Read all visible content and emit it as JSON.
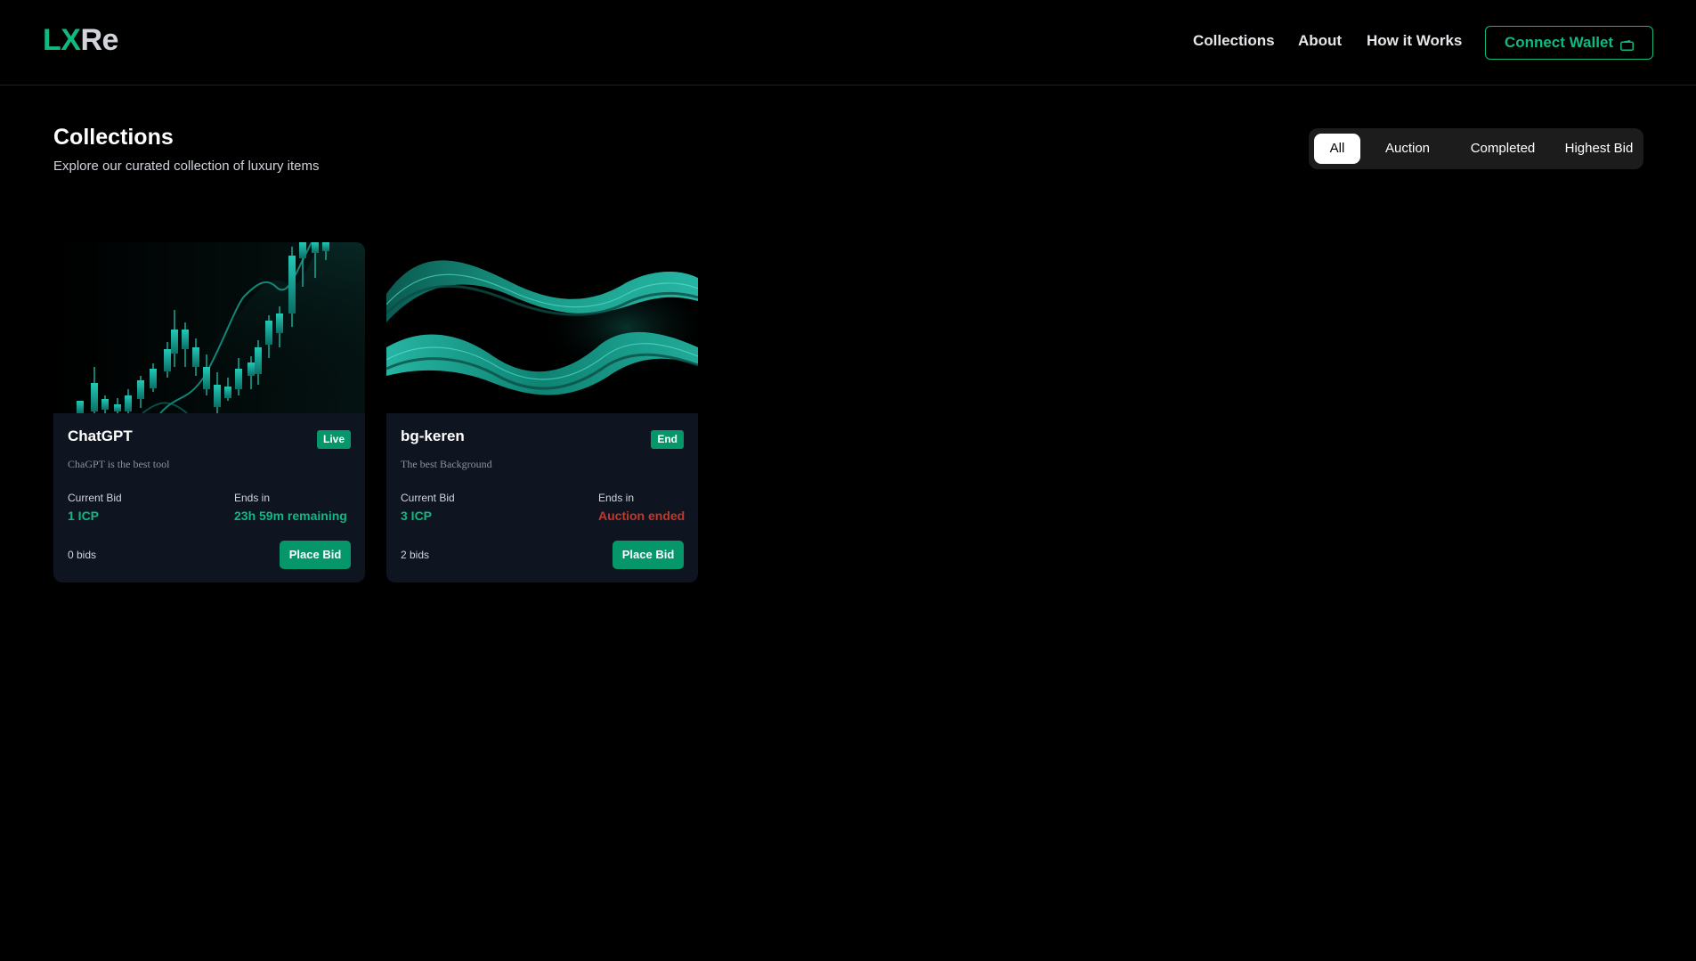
{
  "header": {
    "logo_accent": "LX",
    "logo_rest": "Re",
    "nav": [
      "Collections",
      "About",
      "How it Works"
    ],
    "wallet_label": "Connect Wallet"
  },
  "main": {
    "title": "Collections",
    "subtitle": "Explore our curated collection of luxury items",
    "filters": [
      "All",
      "Auction",
      "Completed",
      "Highest Bid"
    ],
    "active_filter": "All"
  },
  "cards": [
    {
      "title": "ChatGPT",
      "badge": "Live",
      "description": "ChaGPT is the best tool",
      "bid_label": "Current Bid",
      "bid_value": "1 ICP",
      "ends_label": "Ends in",
      "ends_value": "23h 59m remaining",
      "bids": "0 bids",
      "button": "Place Bid"
    },
    {
      "title": "bg-keren",
      "badge": "End",
      "description": "The best Background",
      "bid_label": "Current Bid",
      "bid_value": "3 ICP",
      "ends_label": "Ends in",
      "ends_value": "Auction ended",
      "bids": "2 bids",
      "button": "Place Bid"
    }
  ],
  "colors": {
    "accent": "#10b981",
    "badge": "#059669",
    "ended": "#c0392b",
    "card_bg": "#0e1420"
  },
  "icons": {
    "wallet": "wallet-icon"
  }
}
